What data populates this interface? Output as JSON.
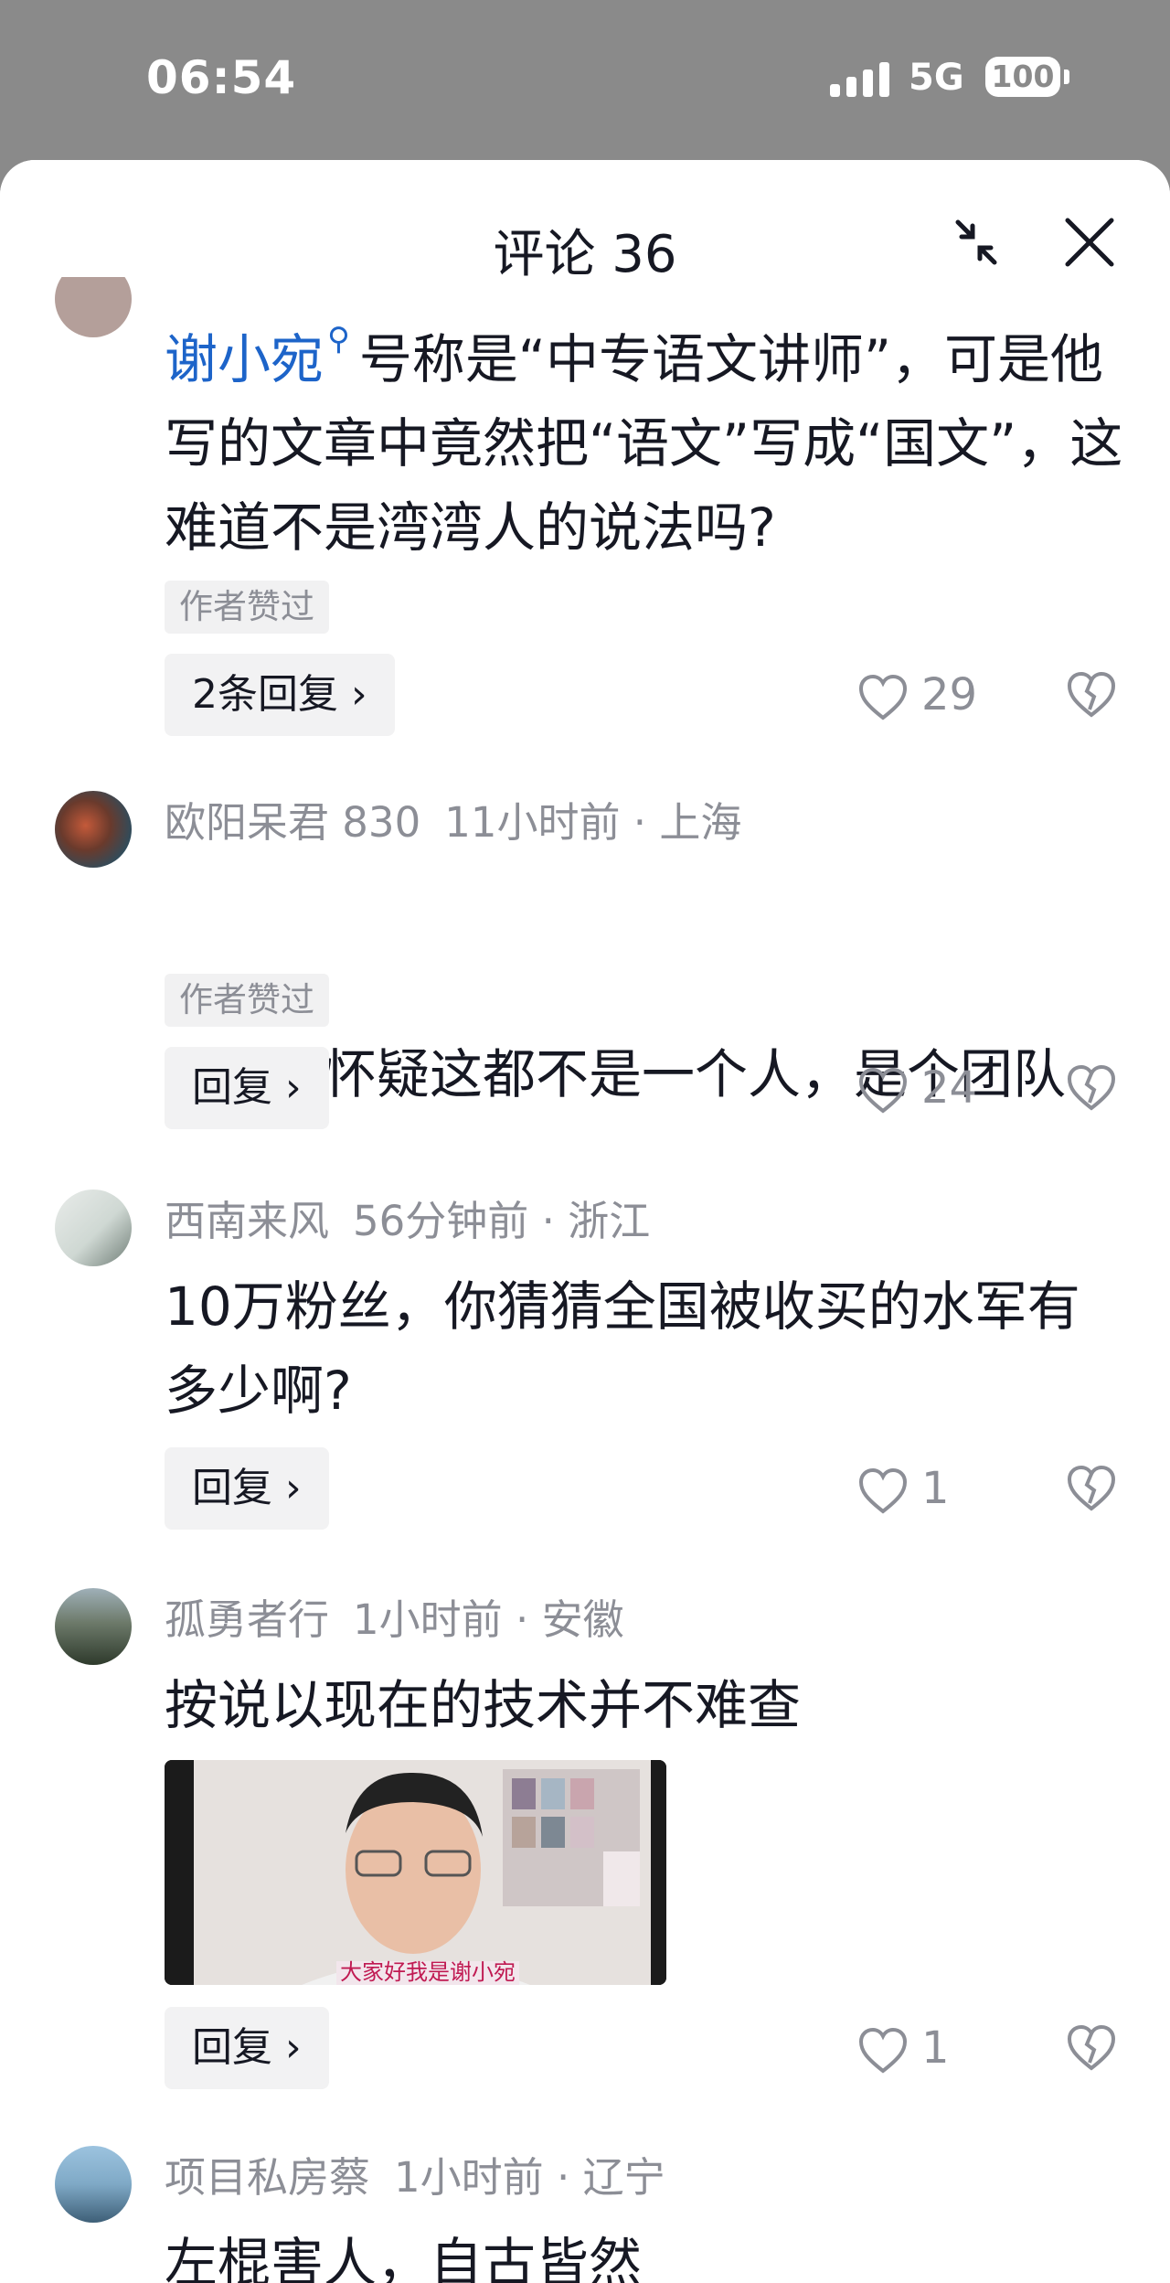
{
  "status": {
    "time": "06:54",
    "network": "5G",
    "battery": "100"
  },
  "header": {
    "title": "评论 36"
  },
  "comments": [
    {
      "mention": "谢小宛",
      "text": "号称是“中专语文讲师”，可是他写的文章中竟然把“语文”写成“国文”，这难道不是湾湾人的说法吗?",
      "badge": "作者赞过",
      "reply_label": "2条回复",
      "likes": "29"
    },
    {
      "user": "欧阳呆君 830",
      "time": "11小时前",
      "location": "上海",
      "text": "我严重怀疑这都不是一个人，是个团队",
      "badge": "作者赞过",
      "reply_label": "回复",
      "likes": "24"
    },
    {
      "user": "西南来风",
      "time": "56分钟前",
      "location": "浙江",
      "text": "10万粉丝，你猜猜全国被收买的水军有多少啊?",
      "reply_label": "回复",
      "likes": "1"
    },
    {
      "user": "孤勇者行",
      "time": "1小时前",
      "location": "安徽",
      "text": "按说以现在的技术并不难查",
      "image_caption": "大家好我是谢小宛",
      "reply_label": "回复",
      "likes": "1"
    },
    {
      "user": "项目私房蔡",
      "time": "1小时前",
      "location": "辽宁",
      "text": "左棍害人，自古皆然"
    }
  ],
  "icons": {
    "collapse": "collapse-icon",
    "close": "close-icon",
    "like": "heart-icon",
    "dislike": "broken-heart-icon",
    "chevron": "chevron-right-icon"
  },
  "colors": {
    "mention": "#1d64c9",
    "muted": "#8c8e96",
    "text": "#161823",
    "overlay": "#8a8a8a"
  }
}
